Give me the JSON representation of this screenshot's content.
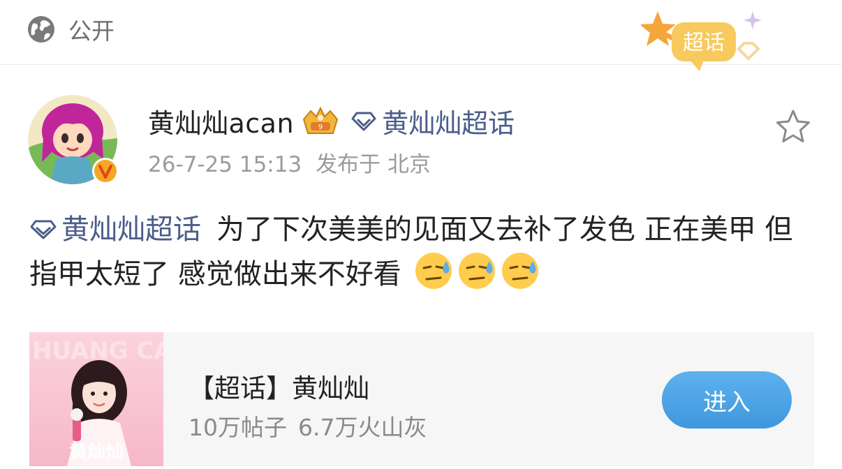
{
  "topbar": {
    "visibility_label": "公开",
    "badge_label": "超话"
  },
  "post": {
    "username": "黄灿灿acan",
    "topic_label": "黄灿灿超话",
    "timestamp": "26-7-25 15:13",
    "location": "发布于 北京",
    "body_topic": "黄灿灿超话",
    "body_text": "为了下次美美的见面又去补了发色 正在美甲 但指甲太短了 感觉做出来不好看"
  },
  "card": {
    "title": "【超话】黄灿灿",
    "posts": "10万帖子",
    "ash": "6.7万火山灰",
    "enter_label": "进入",
    "image_text": "黄灿灿"
  },
  "colors": {
    "link": "#4a5d8a",
    "button": "#4aa3e6",
    "badge": "#f7c04a"
  },
  "icons": [
    "globe-icon",
    "super-topic-badge-icon",
    "crown-icon",
    "diamond-icon",
    "star-icon",
    "verified-icon",
    "sweat-emoji-icon"
  ]
}
